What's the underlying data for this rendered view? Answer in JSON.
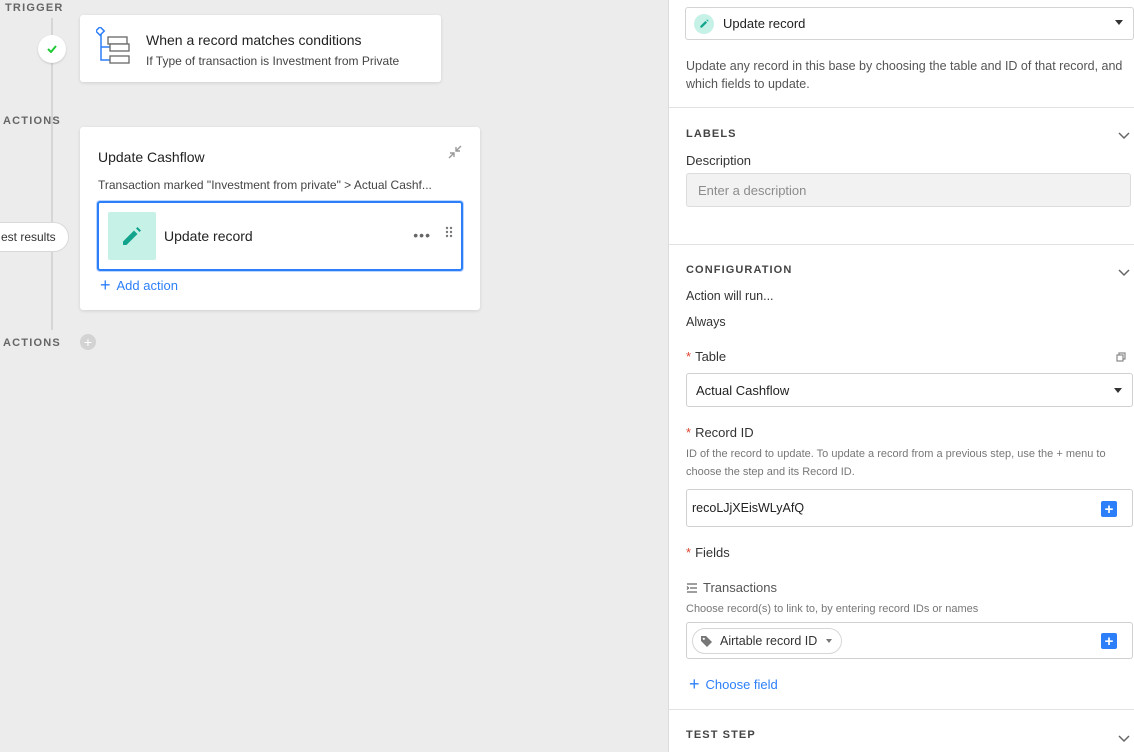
{
  "canvas": {
    "trigger_label": "TRIGGER",
    "actions_label": "ACTIONS",
    "conditional_actions_label": "ACTIONS",
    "test_results_label": "est results",
    "trigger": {
      "title": "When a record matches conditions",
      "subtitle": "If Type of transaction is Investment from Private"
    },
    "action_group": {
      "title": "Update Cashflow",
      "description": "Transaction marked \"Investment from private\" > Actual Cashf...",
      "step_label": "Update record",
      "step_more": "•••",
      "add_action": "Add action"
    }
  },
  "panel": {
    "action_type": "Update record",
    "intro": "Update any record in this base by choosing the table and ID of that record, and which fields to update.",
    "labels": {
      "header": "LABELS",
      "description_label": "Description",
      "description_placeholder": "Enter a description"
    },
    "configuration": {
      "header": "CONFIGURATION",
      "runs_label": "Action will run...",
      "runs_value": "Always",
      "table_label": "Table",
      "table_value": "Actual Cashflow",
      "record_id_label": "Record ID",
      "record_id_help": "ID of the record to update. To update a record from a previous step, use the + menu to choose the step and its Record ID.",
      "record_id_value": "recoLJjXEisWLyAfQ",
      "fields_label": "Fields",
      "transactions_label": "Transactions",
      "transactions_help": "Choose record(s) to link to, by entering record IDs or names",
      "chip_label": "Airtable record ID",
      "choose_field": "Choose field"
    },
    "test_step_header": "TEST STEP",
    "required_mark": "*"
  },
  "colors": {
    "accent_blue": "#2d7ff9",
    "teal_icon": "#11a38b",
    "teal_bg": "#c6f1e7",
    "success_green": "#20c933",
    "required_red": "#e0412f"
  }
}
